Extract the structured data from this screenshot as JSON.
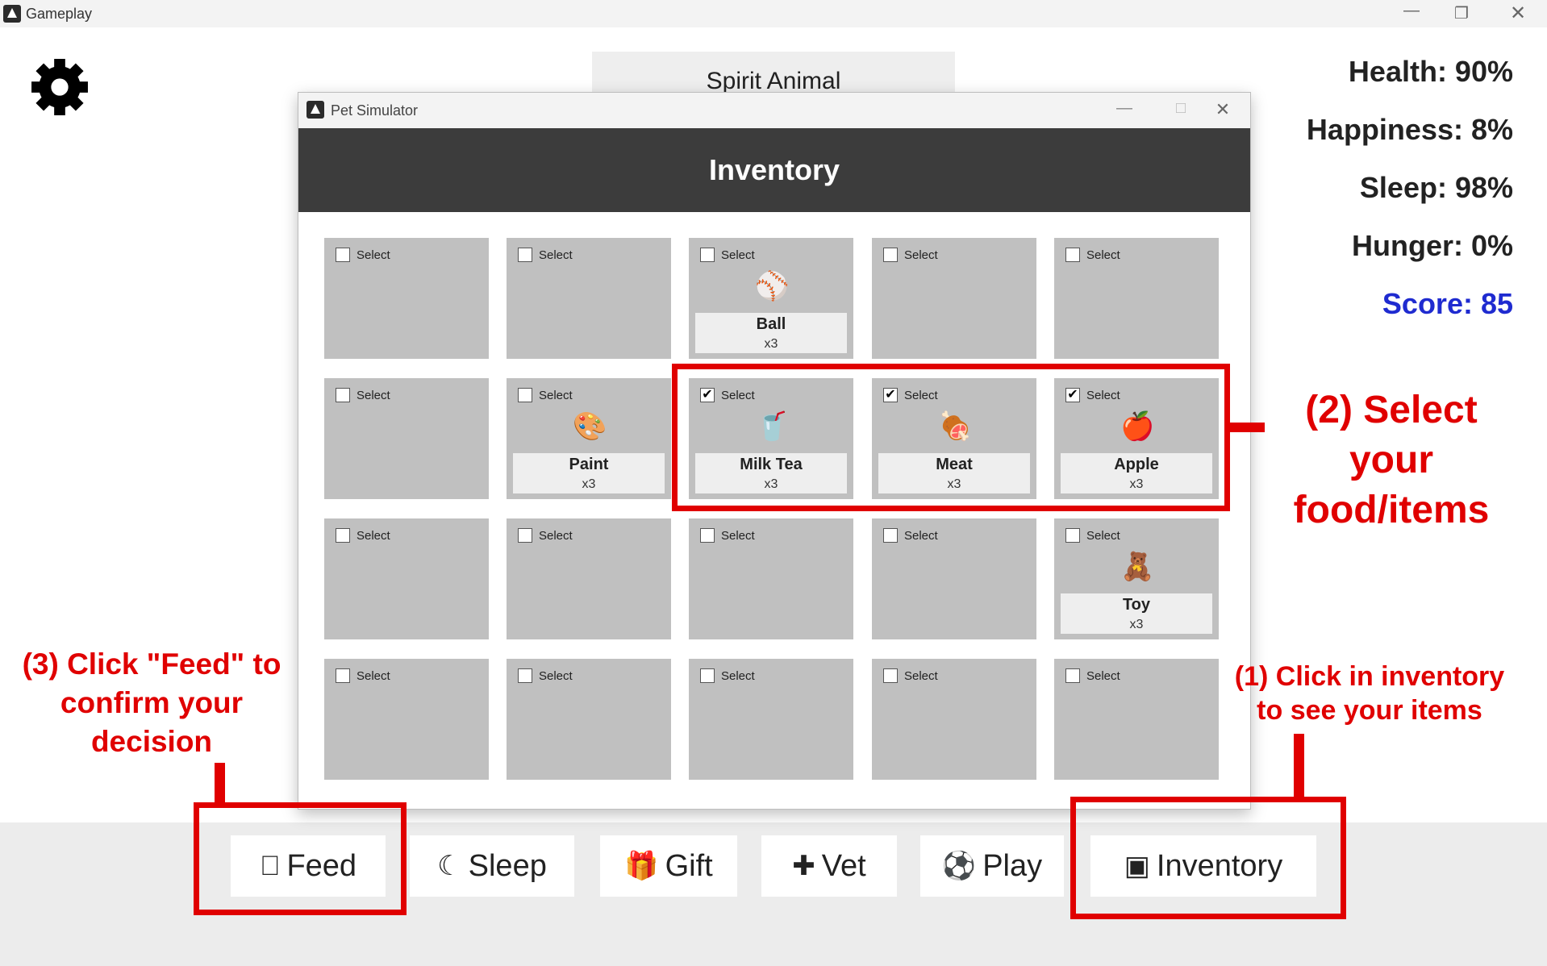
{
  "main_window": {
    "title": "Gameplay"
  },
  "stats": {
    "health": "Health: 90%",
    "happiness": "Happiness: 8%",
    "sleep": "Sleep: 98%",
    "hunger": "Hunger: 0%",
    "score": "Score: 85"
  },
  "pet_title": "Spirit Animal",
  "dialog": {
    "title": "Pet Simulator",
    "header": "Inventory",
    "select_label": "Select",
    "slots": [
      {
        "checked": false,
        "name": "",
        "qty": "",
        "icon": ""
      },
      {
        "checked": false,
        "name": "",
        "qty": "",
        "icon": ""
      },
      {
        "checked": false,
        "name": "Ball",
        "qty": "x3",
        "icon": "baseball-icon"
      },
      {
        "checked": false,
        "name": "",
        "qty": "",
        "icon": ""
      },
      {
        "checked": false,
        "name": "",
        "qty": "",
        "icon": ""
      },
      {
        "checked": false,
        "name": "",
        "qty": "",
        "icon": ""
      },
      {
        "checked": false,
        "name": "Paint",
        "qty": "x3",
        "icon": "palette-icon"
      },
      {
        "checked": true,
        "name": "Milk Tea",
        "qty": "x3",
        "icon": "cup-icon"
      },
      {
        "checked": true,
        "name": "Meat",
        "qty": "x3",
        "icon": "meat-icon"
      },
      {
        "checked": true,
        "name": "Apple",
        "qty": "x3",
        "icon": "apple-icon"
      },
      {
        "checked": false,
        "name": "",
        "qty": "",
        "icon": ""
      },
      {
        "checked": false,
        "name": "",
        "qty": "",
        "icon": ""
      },
      {
        "checked": false,
        "name": "",
        "qty": "",
        "icon": ""
      },
      {
        "checked": false,
        "name": "",
        "qty": "",
        "icon": ""
      },
      {
        "checked": false,
        "name": "Toy",
        "qty": "x3",
        "icon": "teddy-bear-icon"
      },
      {
        "checked": false,
        "name": "",
        "qty": "",
        "icon": ""
      },
      {
        "checked": false,
        "name": "",
        "qty": "",
        "icon": ""
      },
      {
        "checked": false,
        "name": "",
        "qty": "",
        "icon": ""
      },
      {
        "checked": false,
        "name": "",
        "qty": "",
        "icon": ""
      },
      {
        "checked": false,
        "name": "",
        "qty": "",
        "icon": ""
      }
    ]
  },
  "actions": {
    "feed": "Feed",
    "sleep": "Sleep",
    "gift": "Gift",
    "vet": "Vet",
    "play": "Play",
    "inventory": "Inventory"
  },
  "annotations": {
    "step1_line1": "(1) Click in inventory",
    "step1_line2": "to see your items",
    "step2_line1": "(2) Select your",
    "step2_line2": "food/items",
    "step3_line1": "(3) Click \"Feed\" to",
    "step3_line2": "confirm your",
    "step3_line3": "decision"
  },
  "colors": {
    "annotation_red": "#e00000",
    "score_blue": "#1f2bd0",
    "header_dark": "#3c3c3c",
    "slot_gray": "#c0c0c0"
  }
}
